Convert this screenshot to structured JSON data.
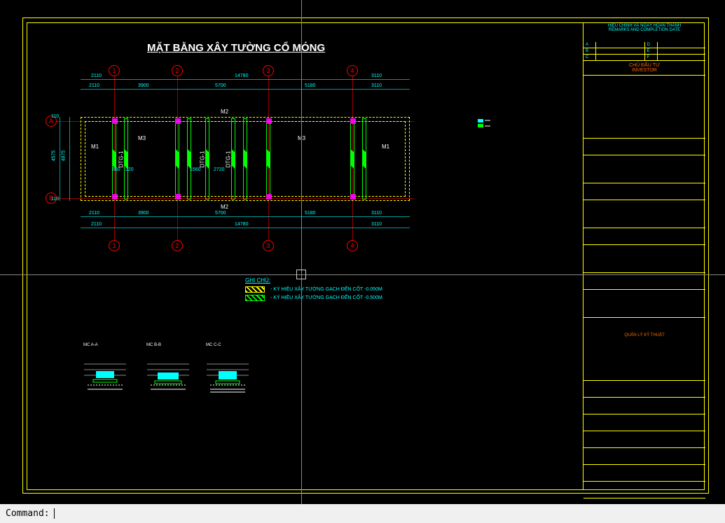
{
  "drawing": {
    "title": "MẶT BẰNG XÂY TƯỜNG CỔ MÓNG",
    "grid_marks_cols": [
      "1",
      "2",
      "3",
      "4"
    ],
    "grid_marks_rows": [
      "A",
      "B"
    ],
    "labels": {
      "M1_left": "M1",
      "M1_right": "M1",
      "M2_top": "M2",
      "M2_bot": "M2",
      "M3_1": "M3",
      "M3_2": "M3",
      "DTG_1": "DTG-1",
      "DTG_2": "DTG-1",
      "DTG_3": "DTG-1"
    },
    "dims_top_outer": [
      "2110",
      "14780",
      "3110"
    ],
    "dims_top_inner": [
      "2110",
      "3900",
      "5700",
      "5180",
      "3110"
    ],
    "dims_bot_inner": [
      "2110",
      "3900",
      "5700",
      "5180",
      "3110"
    ],
    "dims_bot_outer": [
      "2110",
      "14780",
      "3110"
    ],
    "dims_left": [
      "110",
      "4575",
      "4875",
      "110"
    ],
    "dims_inner": [
      "860",
      "220",
      "1560",
      "2720"
    ]
  },
  "legend": {
    "title": "GHI CHÚ:",
    "row1": "- KÝ HIỆU XÂY TƯỜNG GẠCH ĐẾN CỐT -0.050M",
    "row2": "- KÝ HIỆU XÂY TƯỜNG GẠCH ĐẾN CỐT -0.500M"
  },
  "title_block": {
    "rev_header_1": "HIỆU CHỈNH VÀ NGÀY HOÀN THÀNH",
    "rev_header_2": "REMARKS AND COMPLETION DATE",
    "rev_a": "A",
    "rev_b": "B",
    "rev_c": "C",
    "rev_d": "D",
    "rev_e": "E",
    "rev_f": "F",
    "investor_1": "CHỦ ĐẦU TƯ",
    "investor_2": "INVESTOR",
    "stamp": "QUẢN LÝ KỸ THUẬT"
  },
  "details": {
    "d1_title": "MC A-A",
    "d2_title": "MC B-B",
    "d3_title": "MC C-C"
  },
  "cmd": {
    "prompt": "Command:"
  }
}
